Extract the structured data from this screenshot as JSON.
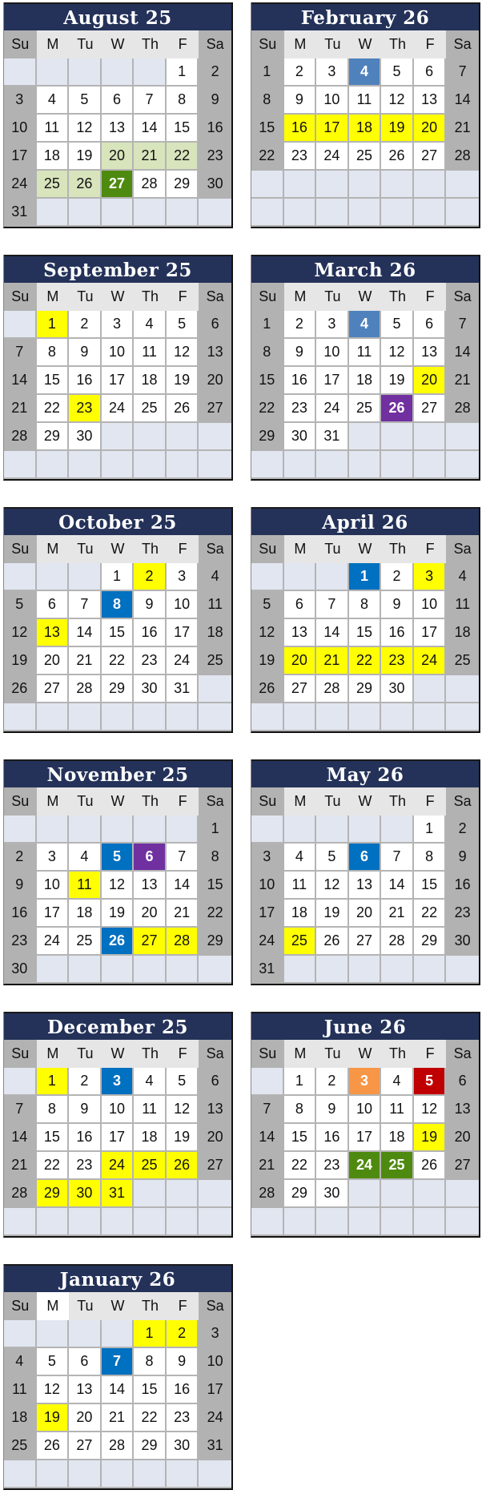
{
  "weekday_labels": [
    "Su",
    "M",
    "Tu",
    "W",
    "Th",
    "F",
    "Sa"
  ],
  "highlight_colors": {
    "yellow": "#ffff00",
    "lightgreen": "#d8e4bc",
    "darkgreen": "#4f8a10",
    "steelblue": "#4f81bd",
    "blue": "#0070c0",
    "purple": "#7030a0",
    "orange": "#f79646",
    "red": "#c00000"
  },
  "calendars": [
    {
      "title": "August 25",
      "weeks": [
        [
          null,
          null,
          null,
          null,
          null,
          "1",
          "2"
        ],
        [
          "3",
          "4",
          "5",
          "6",
          "7",
          "8",
          "9"
        ],
        [
          "10",
          "11",
          "12",
          "13",
          "14",
          "15",
          "16"
        ],
        [
          "17",
          "18",
          "19",
          "20",
          "21",
          "22",
          "23"
        ],
        [
          "24",
          "25",
          "26",
          "27",
          "28",
          "29",
          "30"
        ],
        [
          "31",
          null,
          null,
          null,
          null,
          null,
          null
        ]
      ],
      "highlights": {
        "20": "lightgreen",
        "21": "lightgreen",
        "22": "lightgreen",
        "25": "lightgreen",
        "26": "lightgreen",
        "27": "darkgreen"
      }
    },
    {
      "title": "February 26",
      "weeks": [
        [
          "1",
          "2",
          "3",
          "4",
          "5",
          "6",
          "7"
        ],
        [
          "8",
          "9",
          "10",
          "11",
          "12",
          "13",
          "14"
        ],
        [
          "15",
          "16",
          "17",
          "18",
          "19",
          "20",
          "21"
        ],
        [
          "22",
          "23",
          "24",
          "25",
          "26",
          "27",
          "28"
        ],
        [
          null,
          null,
          null,
          null,
          null,
          null,
          null
        ],
        [
          null,
          null,
          null,
          null,
          null,
          null,
          null
        ]
      ],
      "highlights": {
        "4": "steelblue",
        "16": "yellow",
        "17": "yellow",
        "18": "yellow",
        "19": "yellow",
        "20": "yellow"
      }
    },
    {
      "title": "September 25",
      "weeks": [
        [
          null,
          "1",
          "2",
          "3",
          "4",
          "5",
          "6"
        ],
        [
          "7",
          "8",
          "9",
          "10",
          "11",
          "12",
          "13"
        ],
        [
          "14",
          "15",
          "16",
          "17",
          "18",
          "19",
          "20"
        ],
        [
          "21",
          "22",
          "23",
          "24",
          "25",
          "26",
          "27"
        ],
        [
          "28",
          "29",
          "30",
          null,
          null,
          null,
          null
        ],
        [
          null,
          null,
          null,
          null,
          null,
          null,
          null
        ]
      ],
      "highlights": {
        "1": "yellow",
        "23": "yellow"
      }
    },
    {
      "title": "March 26",
      "weeks": [
        [
          "1",
          "2",
          "3",
          "4",
          "5",
          "6",
          "7"
        ],
        [
          "8",
          "9",
          "10",
          "11",
          "12",
          "13",
          "14"
        ],
        [
          "15",
          "16",
          "17",
          "18",
          "19",
          "20",
          "21"
        ],
        [
          "22",
          "23",
          "24",
          "25",
          "26",
          "27",
          "28"
        ],
        [
          "29",
          "30",
          "31",
          null,
          null,
          null,
          null
        ],
        [
          null,
          null,
          null,
          null,
          null,
          null,
          null
        ]
      ],
      "highlights": {
        "4": "steelblue",
        "20": "yellow",
        "26": "purple"
      }
    },
    {
      "title": "October 25",
      "weeks": [
        [
          null,
          null,
          null,
          "1",
          "2",
          "3",
          "4"
        ],
        [
          "5",
          "6",
          "7",
          "8",
          "9",
          "10",
          "11"
        ],
        [
          "12",
          "13",
          "14",
          "15",
          "16",
          "17",
          "18"
        ],
        [
          "19",
          "20",
          "21",
          "22",
          "23",
          "24",
          "25"
        ],
        [
          "26",
          "27",
          "28",
          "29",
          "30",
          "31",
          null
        ],
        [
          null,
          null,
          null,
          null,
          null,
          null,
          null
        ]
      ],
      "highlights": {
        "2": "yellow",
        "8": "blue",
        "13": "yellow"
      }
    },
    {
      "title": "April 26",
      "weeks": [
        [
          null,
          null,
          null,
          "1",
          "2",
          "3",
          "4"
        ],
        [
          "5",
          "6",
          "7",
          "8",
          "9",
          "10",
          "11"
        ],
        [
          "12",
          "13",
          "14",
          "15",
          "16",
          "17",
          "18"
        ],
        [
          "19",
          "20",
          "21",
          "22",
          "23",
          "24",
          "25"
        ],
        [
          "26",
          "27",
          "28",
          "29",
          "30",
          null,
          null
        ],
        [
          null,
          null,
          null,
          null,
          null,
          null,
          null
        ]
      ],
      "highlights": {
        "1": "blue",
        "3": "yellow",
        "20": "yellow",
        "21": "yellow",
        "22": "yellow",
        "23": "yellow",
        "24": "yellow"
      }
    },
    {
      "title": "November 25",
      "weeks": [
        [
          null,
          null,
          null,
          null,
          null,
          null,
          "1"
        ],
        [
          "2",
          "3",
          "4",
          "5",
          "6",
          "7",
          "8"
        ],
        [
          "9",
          "10",
          "11",
          "12",
          "13",
          "14",
          "15"
        ],
        [
          "16",
          "17",
          "18",
          "19",
          "20",
          "21",
          "22"
        ],
        [
          "23",
          "24",
          "25",
          "26",
          "27",
          "28",
          "29"
        ],
        [
          "30",
          null,
          null,
          null,
          null,
          null,
          null
        ]
      ],
      "highlights": {
        "5": "blue",
        "6": "purple",
        "11": "yellow",
        "26": "blue",
        "27": "yellow",
        "28": "yellow"
      }
    },
    {
      "title": "May 26",
      "weeks": [
        [
          null,
          null,
          null,
          null,
          null,
          "1",
          "2"
        ],
        [
          "3",
          "4",
          "5",
          "6",
          "7",
          "8",
          "9"
        ],
        [
          "10",
          "11",
          "12",
          "13",
          "14",
          "15",
          "16"
        ],
        [
          "17",
          "18",
          "19",
          "20",
          "21",
          "22",
          "23"
        ],
        [
          "24",
          "25",
          "26",
          "27",
          "28",
          "29",
          "30"
        ],
        [
          "31",
          null,
          null,
          null,
          null,
          null,
          null
        ]
      ],
      "highlights": {
        "6": "blue",
        "25": "yellow"
      }
    },
    {
      "title": "December 25",
      "weeks": [
        [
          null,
          "1",
          "2",
          "3",
          "4",
          "5",
          "6"
        ],
        [
          "7",
          "8",
          "9",
          "10",
          "11",
          "12",
          "13"
        ],
        [
          "14",
          "15",
          "16",
          "17",
          "18",
          "19",
          "20"
        ],
        [
          "21",
          "22",
          "23",
          "24",
          "25",
          "26",
          "27"
        ],
        [
          "28",
          "29",
          "30",
          "31",
          null,
          null,
          null
        ],
        [
          null,
          null,
          null,
          null,
          null,
          null,
          null
        ]
      ],
      "highlights": {
        "1": "yellow",
        "3": "blue",
        "24": "yellow",
        "25": "yellow",
        "26": "yellow",
        "29": "yellow",
        "30": "yellow",
        "31": "yellow"
      }
    },
    {
      "title": "June 26",
      "weeks": [
        [
          null,
          "1",
          "2",
          "3",
          "4",
          "5",
          "6"
        ],
        [
          "7",
          "8",
          "9",
          "10",
          "11",
          "12",
          "13"
        ],
        [
          "14",
          "15",
          "16",
          "17",
          "18",
          "19",
          "20"
        ],
        [
          "21",
          "22",
          "23",
          "24",
          "25",
          "26",
          "27"
        ],
        [
          "28",
          "29",
          "30",
          null,
          null,
          null,
          null
        ],
        [
          null,
          null,
          null,
          null,
          null,
          null,
          null
        ]
      ],
      "highlights": {
        "3": "orange",
        "5": "red",
        "19": "yellow",
        "24": "darkgreen",
        "25": "darkgreen"
      }
    },
    {
      "title": "January 26",
      "weeks": [
        [
          null,
          null,
          null,
          null,
          "1",
          "2",
          "3"
        ],
        [
          "4",
          "5",
          "6",
          "7",
          "8",
          "9",
          "10"
        ],
        [
          "11",
          "12",
          "13",
          "14",
          "15",
          "16",
          "17"
        ],
        [
          "18",
          "19",
          "20",
          "21",
          "22",
          "23",
          "24"
        ],
        [
          "25",
          "26",
          "27",
          "28",
          "29",
          "30",
          "31"
        ],
        [
          null,
          null,
          null,
          null,
          null,
          null,
          null
        ]
      ],
      "highlights": {
        "1": "yellow",
        "2": "yellow",
        "7": "blue",
        "19": "yellow"
      },
      "monday_header_white": true
    }
  ]
}
